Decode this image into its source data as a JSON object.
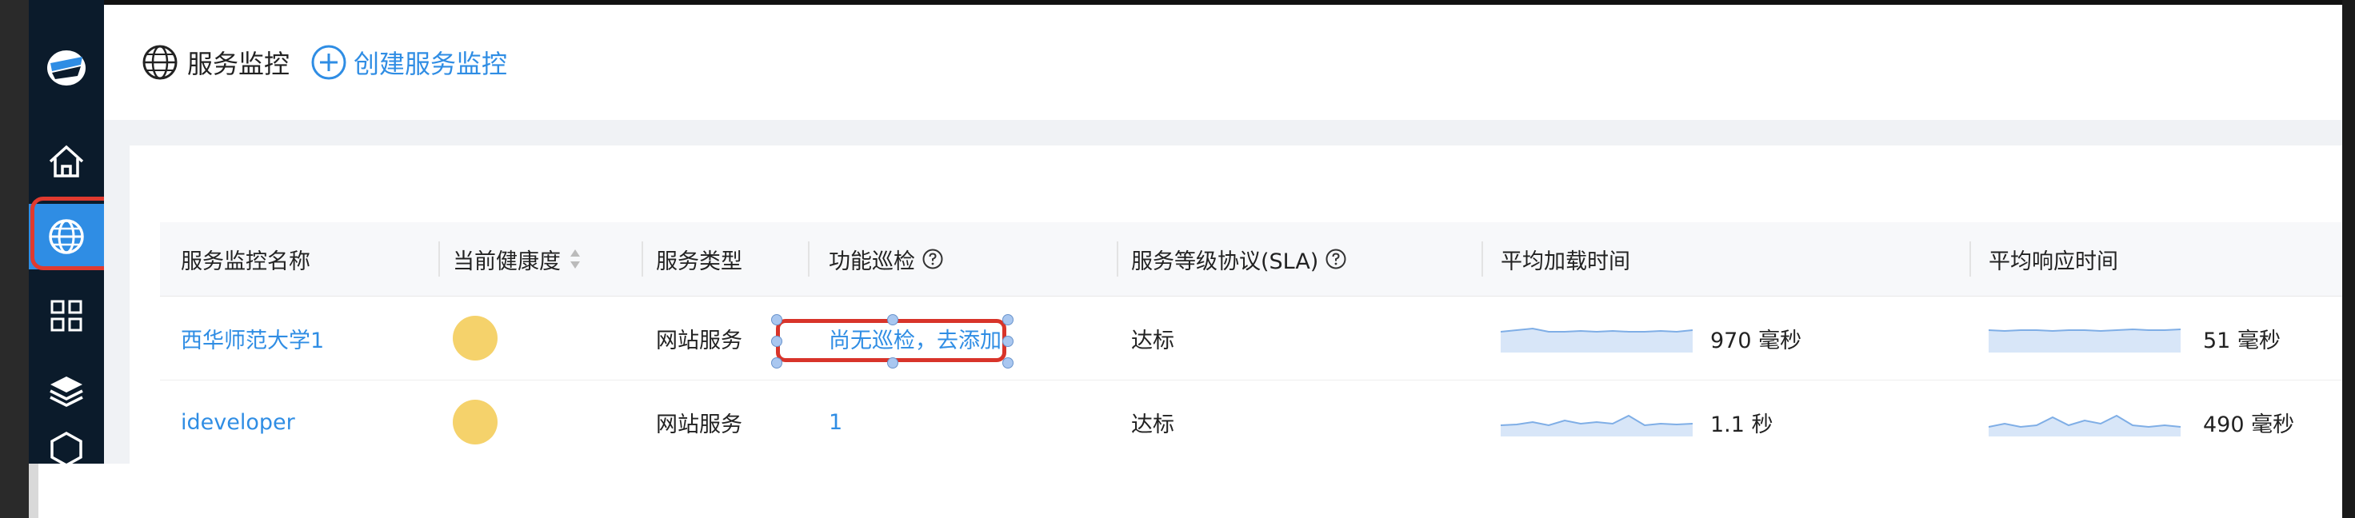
{
  "header": {
    "title": "服务监控",
    "create_label": "创建服务监控"
  },
  "sidebar": {
    "items": [
      {
        "icon": "logo-icon"
      },
      {
        "icon": "home-icon"
      },
      {
        "icon": "globe-icon",
        "active": true
      },
      {
        "icon": "grid-icon"
      },
      {
        "icon": "layers-icon"
      },
      {
        "icon": "box-icon"
      }
    ]
  },
  "table": {
    "columns": [
      {
        "label": "服务监控名称"
      },
      {
        "label": "当前健康度"
      },
      {
        "label": "服务类型"
      },
      {
        "label": "功能巡检"
      },
      {
        "label": "服务等级协议(SLA)"
      },
      {
        "label": "平均加载时间"
      },
      {
        "label": "平均响应时间"
      }
    ],
    "rows": [
      {
        "name": "西华师范大学1",
        "health_color": "#f5d26b",
        "type": "网站服务",
        "inspection": "尚无巡检，去添加",
        "sla": "达标",
        "load_time": "970 毫秒",
        "response_time": "51 毫秒"
      },
      {
        "name": "ideveloper",
        "health_color": "#f5d26b",
        "type": "网站服务",
        "inspection": "1",
        "sla": "达标",
        "load_time": "1.1 秒",
        "response_time": "490 毫秒"
      }
    ]
  },
  "colors": {
    "accent": "#2f8de4",
    "sidebar_bg": "#0b1b2b",
    "highlight": "#e03a2f",
    "health_warning": "#f5d26b"
  }
}
